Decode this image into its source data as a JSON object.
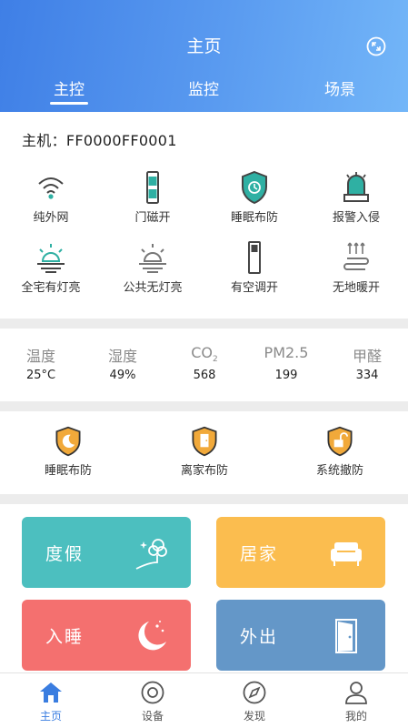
{
  "header": {
    "title": "主页",
    "tabs": [
      {
        "label": "主控",
        "active": true
      },
      {
        "label": "监控",
        "active": false
      },
      {
        "label": "场景",
        "active": false
      }
    ]
  },
  "host": {
    "label": "主机：FF0000FF0001"
  },
  "status_items": [
    {
      "label": "纯外网",
      "icon": "wifi-icon"
    },
    {
      "label": "门磁开",
      "icon": "door-sensor-icon"
    },
    {
      "label": "睡眠布防",
      "icon": "shield-sleep-icon"
    },
    {
      "label": "报警入侵",
      "icon": "alarm-siren-icon"
    },
    {
      "label": "全宅有灯亮",
      "icon": "lights-on-icon"
    },
    {
      "label": "公共无灯亮",
      "icon": "lights-off-icon"
    },
    {
      "label": "有空调开",
      "icon": "air-conditioner-icon"
    },
    {
      "label": "无地暖开",
      "icon": "floor-heating-icon"
    }
  ],
  "sensors": [
    {
      "name": "温度",
      "value": "25°C"
    },
    {
      "name": "湿度",
      "value": "49%"
    },
    {
      "name": "CO",
      "sub": "2",
      "value": "568"
    },
    {
      "name": "PM2.5",
      "value": "199"
    },
    {
      "name": "甲醛",
      "value": "334"
    }
  ],
  "modes": [
    {
      "label": "睡眠布防",
      "icon": "shield-moon-icon"
    },
    {
      "label": "离家布防",
      "icon": "shield-door-icon"
    },
    {
      "label": "系统撤防",
      "icon": "shield-unlock-icon"
    }
  ],
  "scenes": [
    {
      "label": "度假",
      "color": "#4cbfbf",
      "icon": "tree-icon"
    },
    {
      "label": "居家",
      "color": "#fbbd4f",
      "icon": "sofa-icon"
    },
    {
      "label": "入睡",
      "color": "#f4706f",
      "icon": "moon-stars-icon"
    },
    {
      "label": "外出",
      "color": "#6497c8",
      "icon": "door-icon"
    }
  ],
  "bottom_nav": [
    {
      "label": "主页",
      "active": true,
      "icon": "home-icon"
    },
    {
      "label": "设备",
      "active": false,
      "icon": "device-icon"
    },
    {
      "label": "发现",
      "active": false,
      "icon": "compass-icon"
    },
    {
      "label": "我的",
      "active": false,
      "icon": "user-icon"
    }
  ],
  "colors": {
    "accent": "#3a7de0",
    "header_start": "#3f7fe6",
    "header_end": "#73b6f8",
    "shield": "#f1a93a",
    "teal": "#2fb0a3"
  }
}
